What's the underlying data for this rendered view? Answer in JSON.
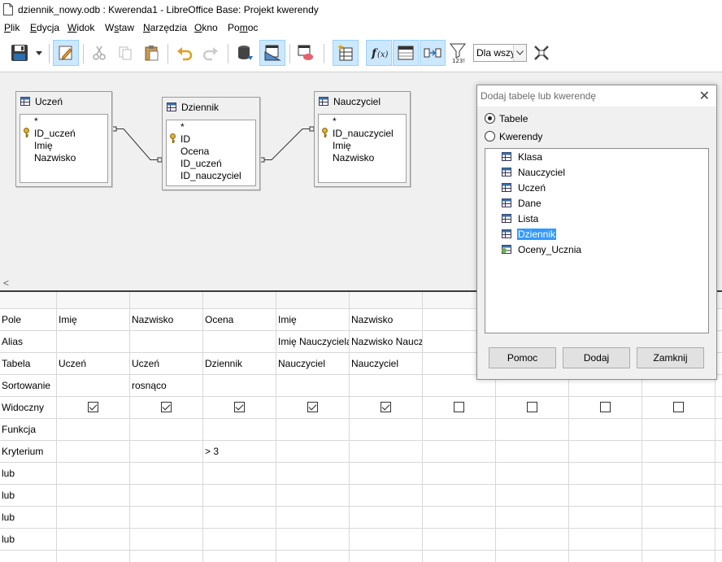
{
  "window": {
    "title": "dziennik_nowy.odb : Kwerenda1 - LibreOffice Base: Projekt kwerendy"
  },
  "menu": [
    {
      "label": "Plik"
    },
    {
      "label": "Edycja"
    },
    {
      "label": "Widok"
    },
    {
      "label": "Wstaw"
    },
    {
      "label": "Narzędzia"
    },
    {
      "label": "Okno"
    },
    {
      "label": "Pomoc"
    }
  ],
  "toolbar": {
    "icons": [
      "save-icon",
      "save-dropdown-icon",
      "edit-mode-icon",
      "cut-icon",
      "copy-icon",
      "paste-icon",
      "undo-icon",
      "redo-icon",
      "run-query-icon",
      "clear-query-icon",
      "design-view-icon",
      "add-table-icon",
      "functions-icon",
      "table-name-icon",
      "alias-icon",
      "distinct-values-icon"
    ],
    "limit_value": "Dla wszy",
    "active": [
      "edit-mode-icon",
      "design-view-icon",
      "add-table-icon",
      "functions-icon",
      "table-name-icon",
      "alias-icon"
    ]
  },
  "tables": [
    {
      "name": "Uczeń",
      "fields": [
        "*",
        "ID_uczeń",
        "Imię",
        "Nazwisko"
      ],
      "key_field": "ID_uczeń"
    },
    {
      "name": "Dziennik",
      "fields": [
        "*",
        "ID",
        "Ocena",
        "ID_uczeń",
        "ID_nauczyciel"
      ],
      "key_field": "ID"
    },
    {
      "name": "Nauczyciel",
      "fields": [
        "*",
        "ID_nauczyciel",
        "Imię",
        "Nazwisko"
      ],
      "key_field": "ID_nauczyciel"
    }
  ],
  "scroll": {
    "left_arrow": "<"
  },
  "grid": {
    "row_labels": [
      "Pole",
      "Alias",
      "Tabela",
      "Sortowanie",
      "Widoczny",
      "Funkcja",
      "Kryterium",
      "lub",
      "lub",
      "lub",
      "lub"
    ],
    "columns": [
      {
        "field": "Imię",
        "alias": "",
        "table": "Uczeń",
        "sort": "",
        "visible": true,
        "criterion": ""
      },
      {
        "field": "Nazwisko",
        "alias": "",
        "table": "Uczeń",
        "sort": "rosnąco",
        "visible": true,
        "criterion": ""
      },
      {
        "field": "Ocena",
        "alias": "",
        "table": "Dziennik",
        "sort": "",
        "visible": true,
        "criterion": "> 3"
      },
      {
        "field": "Imię",
        "alias": "Imię Nauczyciela",
        "table": "Nauczyciel",
        "sort": "",
        "visible": true,
        "criterion": ""
      },
      {
        "field": "Nazwisko",
        "alias": "Nazwisko Nauczyciela",
        "table": "Nauczyciel",
        "sort": "",
        "visible": true,
        "criterion": ""
      },
      {
        "field": "",
        "alias": "",
        "table": "",
        "sort": "",
        "visible": false,
        "criterion": ""
      },
      {
        "field": "",
        "alias": "",
        "table": "",
        "sort": "",
        "visible": false,
        "criterion": ""
      },
      {
        "field": "",
        "alias": "",
        "table": "",
        "sort": "",
        "visible": false,
        "criterion": ""
      },
      {
        "field": "",
        "alias": "",
        "table": "",
        "sort": "",
        "visible": false,
        "criterion": ""
      }
    ]
  },
  "dialog": {
    "title": "Dodaj tabelę lub kwerendę",
    "radio_tables": "Tabele",
    "radio_queries": "Kwerendy",
    "selected_radio": "tables",
    "items": [
      {
        "label": "Klasa",
        "type": "table"
      },
      {
        "label": "Nauczyciel",
        "type": "table"
      },
      {
        "label": "Uczeń",
        "type": "table"
      },
      {
        "label": "Dane",
        "type": "table"
      },
      {
        "label": "Lista",
        "type": "table"
      },
      {
        "label": "Dziennik",
        "type": "table",
        "selected": true
      },
      {
        "label": "Oceny_Ucznia",
        "type": "query"
      }
    ],
    "btn_help": "Pomoc",
    "btn_add": "Dodaj",
    "btn_close": "Zamknij"
  },
  "colors": {
    "selection": "#3399ff",
    "active_button": "#cce8ff",
    "design_bg": "#f0f0f0"
  }
}
